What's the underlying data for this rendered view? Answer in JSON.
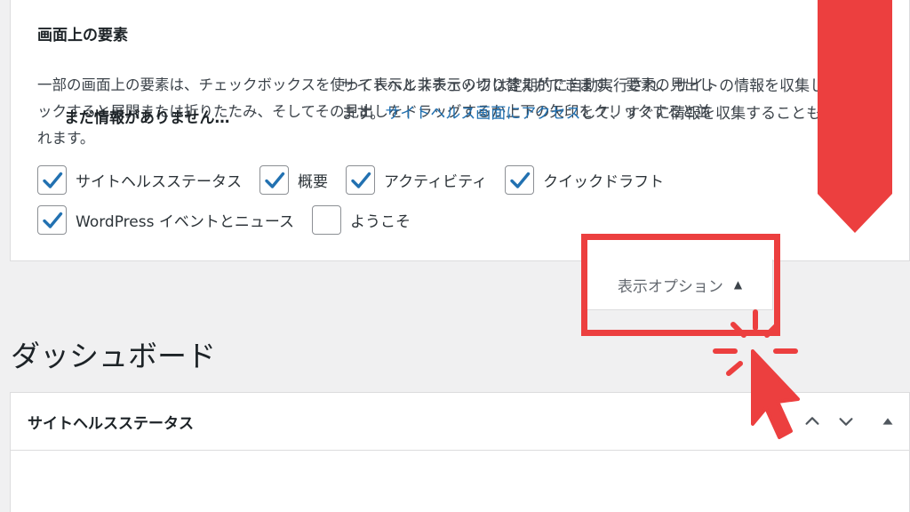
{
  "screen_options": {
    "title": "画面上の要素",
    "description_lines": [
      "一部の画面上の要素は、チェックボックスを使って表示と非表示の切り替えができます。 要素の見出し",
      "ックすると展開または折りたたみ、そしてその見出しをドラッグするか上下の矢印をクリックすると並",
      "れます。"
    ],
    "checkboxes": [
      {
        "label": "サイトヘルスステータス",
        "checked": true
      },
      {
        "label": "概要",
        "checked": true
      },
      {
        "label": "アクティビティ",
        "checked": true
      },
      {
        "label": "クイックドラフト",
        "checked": true
      },
      {
        "label": "WordPress イベントとニュース",
        "checked": true
      },
      {
        "label": "ようこそ",
        "checked": false
      }
    ],
    "toggle_label": "表示オプション",
    "toggle_icon": "triangle-up-icon"
  },
  "page": {
    "title": "ダッシュボード"
  },
  "site_health": {
    "title": "サイトヘルスステータス",
    "controls": [
      "chevron-up-icon",
      "chevron-down-icon",
      "triangle-up-icon"
    ],
    "no_info": "まだ情報がありません…",
    "text_line1": "サイトヘルスチェックは定期的に自動実行され、サイトの情報を収集し",
    "text_line2_before": "ます。",
    "text_link": "サイトヘルス画面にアクセス",
    "text_line2_after": "して、すぐに情報を収集することも"
  },
  "colors": {
    "annotation_red": "#ec3f3f",
    "wp_blue": "#2271b1",
    "checkbox_check": "#2271b1"
  },
  "annotations": {
    "arrow_icon": "arrow-down-icon",
    "cursor_icon": "click-cursor-icon"
  }
}
